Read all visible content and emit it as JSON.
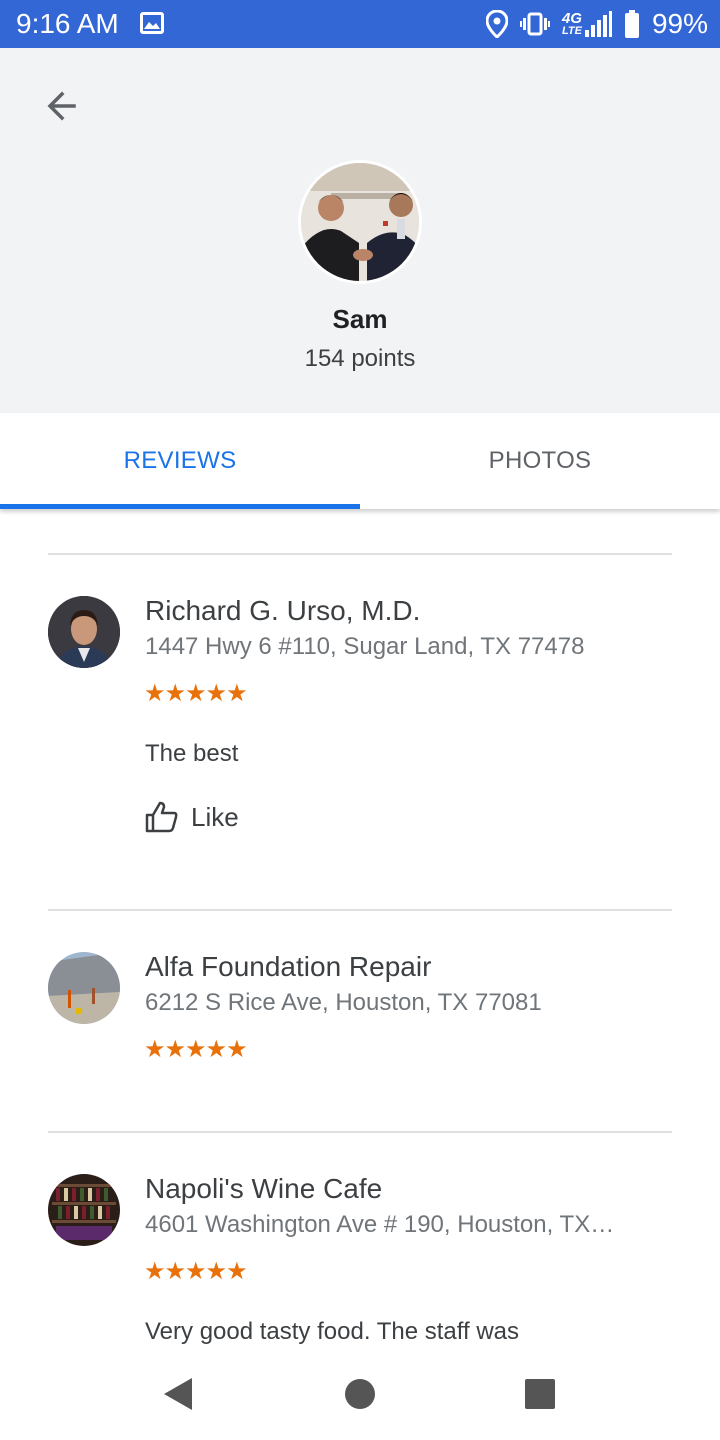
{
  "status_bar": {
    "time": "9:16 AM",
    "battery_percent": "99%",
    "network_label": "4G",
    "network_sub_label": "LTE",
    "icons": [
      "gallery-icon",
      "location-icon",
      "vibrate-icon",
      "signal-icon",
      "battery-icon"
    ]
  },
  "profile": {
    "name": "Sam",
    "points": "154 points"
  },
  "tabs": [
    {
      "label": "REVIEWS",
      "active": true
    },
    {
      "label": "PHOTOS",
      "active": false
    }
  ],
  "reviews": [
    {
      "place_name": "Richard G. Urso, M.D.",
      "address": "1447 Hwy 6 #110, Sugar Land, TX 77478",
      "stars": "★★★★★",
      "rating": 5,
      "text": "The best",
      "like_label": "Like"
    },
    {
      "place_name": "Alfa Foundation Repair",
      "address": "6212 S Rice Ave, Houston, TX 77081",
      "stars": "★★★★★",
      "rating": 5
    },
    {
      "place_name": "Napoli's Wine Cafe",
      "address": "4601 Washington Ave # 190, Houston, TX…",
      "stars": "★★★★★",
      "rating": 5,
      "text": "Very good tasty food. The staff was"
    }
  ],
  "colors": {
    "status_bar": "#3367d6",
    "accent": "#1a73e8",
    "star": "#e8710a",
    "header_bg": "#f1f3f4"
  },
  "nav_bar": {
    "icons": [
      "back-triangle-icon",
      "home-circle-icon",
      "recents-square-icon"
    ]
  }
}
